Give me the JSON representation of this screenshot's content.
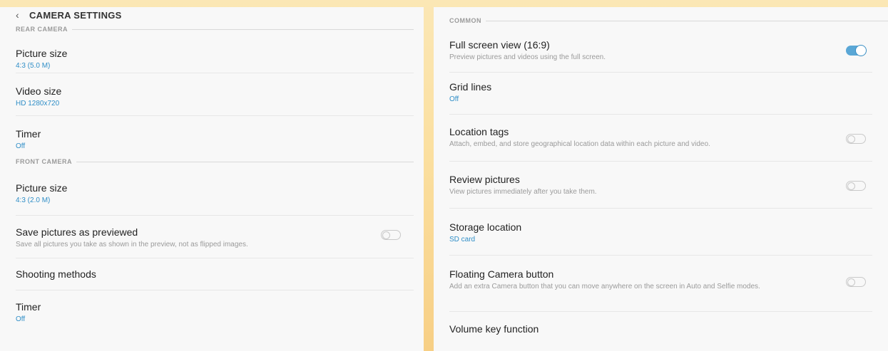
{
  "left": {
    "header": {
      "back_icon": "chevron-left-icon",
      "title": "CAMERA SETTINGS"
    },
    "rear_section": "REAR CAMERA",
    "rear_items": [
      {
        "title": "Picture size",
        "value": "4:3 (5.0 M)"
      },
      {
        "title": "Video size",
        "value": "HD 1280x720"
      },
      {
        "title": "Timer",
        "value": "Off"
      }
    ],
    "front_section": "FRONT CAMERA",
    "front_items": {
      "picture_size": {
        "title": "Picture size",
        "value": "4:3 (2.0 M)"
      },
      "save_previewed": {
        "title": "Save pictures as previewed",
        "description": "Save all pictures you take as shown in the preview, not as flipped images.",
        "toggle": "off"
      },
      "shooting_methods": {
        "title": "Shooting methods"
      },
      "timer": {
        "title": "Timer",
        "value": "Off"
      }
    }
  },
  "right": {
    "common_section": "COMMON",
    "full_screen": {
      "title": "Full screen view (16:9)",
      "description": "Preview pictures and videos using the full screen.",
      "toggle": "on"
    },
    "grid_lines": {
      "title": "Grid lines",
      "value": "Off"
    },
    "location_tags": {
      "title": "Location tags",
      "description": "Attach, embed, and store geographical location data within each picture and video.",
      "toggle": "off"
    },
    "review_pictures": {
      "title": "Review pictures",
      "description": "View pictures immediately after you take them.",
      "toggle": "off"
    },
    "storage_location": {
      "title": "Storage location",
      "value": "SD card"
    },
    "floating_button": {
      "title": "Floating Camera button",
      "description": "Add an extra Camera button that you can move anywhere on the screen in Auto and Selfie modes.",
      "toggle": "off"
    },
    "volume_key": {
      "title": "Volume key function"
    }
  },
  "colors": {
    "accent": "#2f8ec7",
    "toggle_on": "#5aa7d6",
    "background": "#fbdf9f"
  }
}
